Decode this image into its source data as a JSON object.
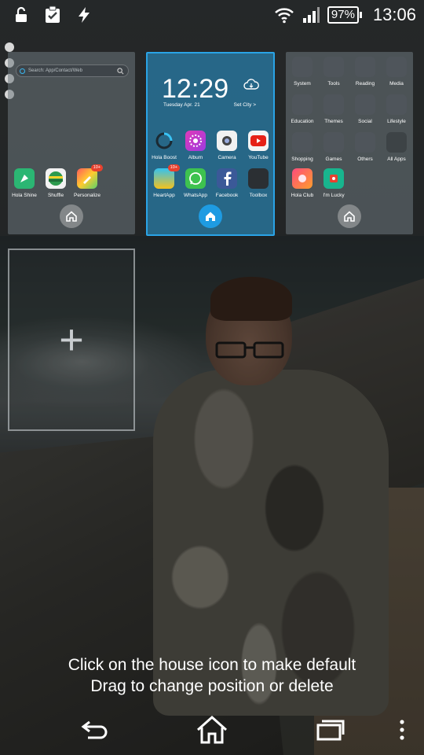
{
  "status_bar": {
    "left_icons": [
      "unlock-icon",
      "clipboard-check-icon",
      "flash-icon"
    ],
    "right_icons": [
      "wifi-icon",
      "signal-icon"
    ],
    "battery": "97%",
    "time": "13:06"
  },
  "page_dots_count": 4,
  "screens": {
    "left": {
      "search_placeholder": "Search: App/Contact/Web",
      "apps": [
        {
          "label": "Hola Shine",
          "icon": "hola-shine-icon",
          "color": "#2bb673"
        },
        {
          "label": "Shuffle",
          "icon": "shuffle-icon",
          "color": "#f0f0f0"
        },
        {
          "label": "Personalize",
          "icon": "personalize-icon",
          "color": "#ffcb2f",
          "badge": "10+"
        }
      ]
    },
    "center": {
      "clock_hours": "12",
      "clock_minutes": "29",
      "date": "Tuesday Apr. 21",
      "set_city": "Set City >",
      "apps": [
        {
          "label": "Hola Boost",
          "icon": "hola-boost-icon"
        },
        {
          "label": "Album",
          "icon": "album-icon"
        },
        {
          "label": "Camera",
          "icon": "camera-icon"
        },
        {
          "label": "YouTube",
          "icon": "youtube-icon"
        },
        {
          "label": "HeartApp",
          "icon": "heartapp-icon",
          "badge": "10+"
        },
        {
          "label": "WhatsApp",
          "icon": "whatsapp-icon"
        },
        {
          "label": "Facebook",
          "icon": "facebook-icon"
        },
        {
          "label": "Toolbox",
          "icon": "toolbox-icon"
        }
      ]
    },
    "right": {
      "folders": [
        {
          "label": "System"
        },
        {
          "label": "Tools"
        },
        {
          "label": "Reading"
        },
        {
          "label": "Media"
        },
        {
          "label": "Education"
        },
        {
          "label": "Themes"
        },
        {
          "label": "Social"
        },
        {
          "label": "Lifestyle"
        },
        {
          "label": "Shopping"
        },
        {
          "label": "Games"
        },
        {
          "label": "Others"
        },
        {
          "label": "All Apps"
        }
      ],
      "apps": [
        {
          "label": "Hola Club",
          "icon": "hola-club-icon"
        },
        {
          "label": "I'm Lucky",
          "icon": "im-lucky-icon"
        }
      ]
    }
  },
  "add_screen_symbol": "+",
  "hint": {
    "line1": "Click on the house icon to make default",
    "line2": "Drag to change position or delete"
  },
  "navigation": [
    "back-icon",
    "home-icon",
    "recents-icon",
    "menu-icon"
  ]
}
